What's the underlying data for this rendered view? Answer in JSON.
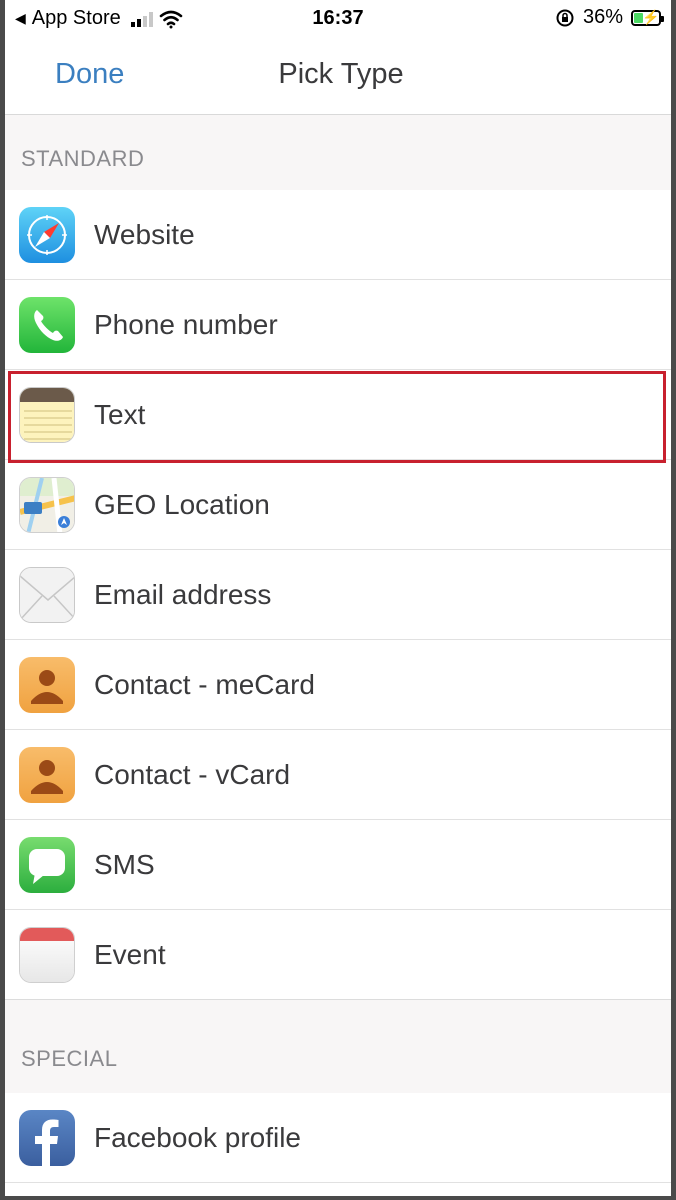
{
  "status_bar": {
    "back_app": "App Store",
    "time": "16:37",
    "battery_percent": "36%",
    "battery_level": 0.36,
    "charging": true
  },
  "nav": {
    "done_label": "Done",
    "title": "Pick Type"
  },
  "sections": {
    "standard": "STANDARD",
    "special": "SPECIAL"
  },
  "items": [
    {
      "label": "Website",
      "icon": "safari-compass-icon"
    },
    {
      "label": "Phone number",
      "icon": "phone-icon"
    },
    {
      "label": "Text",
      "icon": "notes-icon",
      "selected": true
    },
    {
      "label": "GEO Location",
      "icon": "maps-icon"
    },
    {
      "label": "Email address",
      "icon": "envelope-icon"
    },
    {
      "label": "Contact - meCard",
      "icon": "contact-icon"
    },
    {
      "label": "Contact - vCard",
      "icon": "contact-icon"
    },
    {
      "label": "SMS",
      "icon": "message-bubble-icon"
    },
    {
      "label": "Event",
      "icon": "calendar-icon"
    },
    {
      "label": "Facebook profile",
      "icon": "facebook-icon"
    }
  ],
  "colors": {
    "accent": "#3b7fc0",
    "selection_border": "#c8202e"
  }
}
